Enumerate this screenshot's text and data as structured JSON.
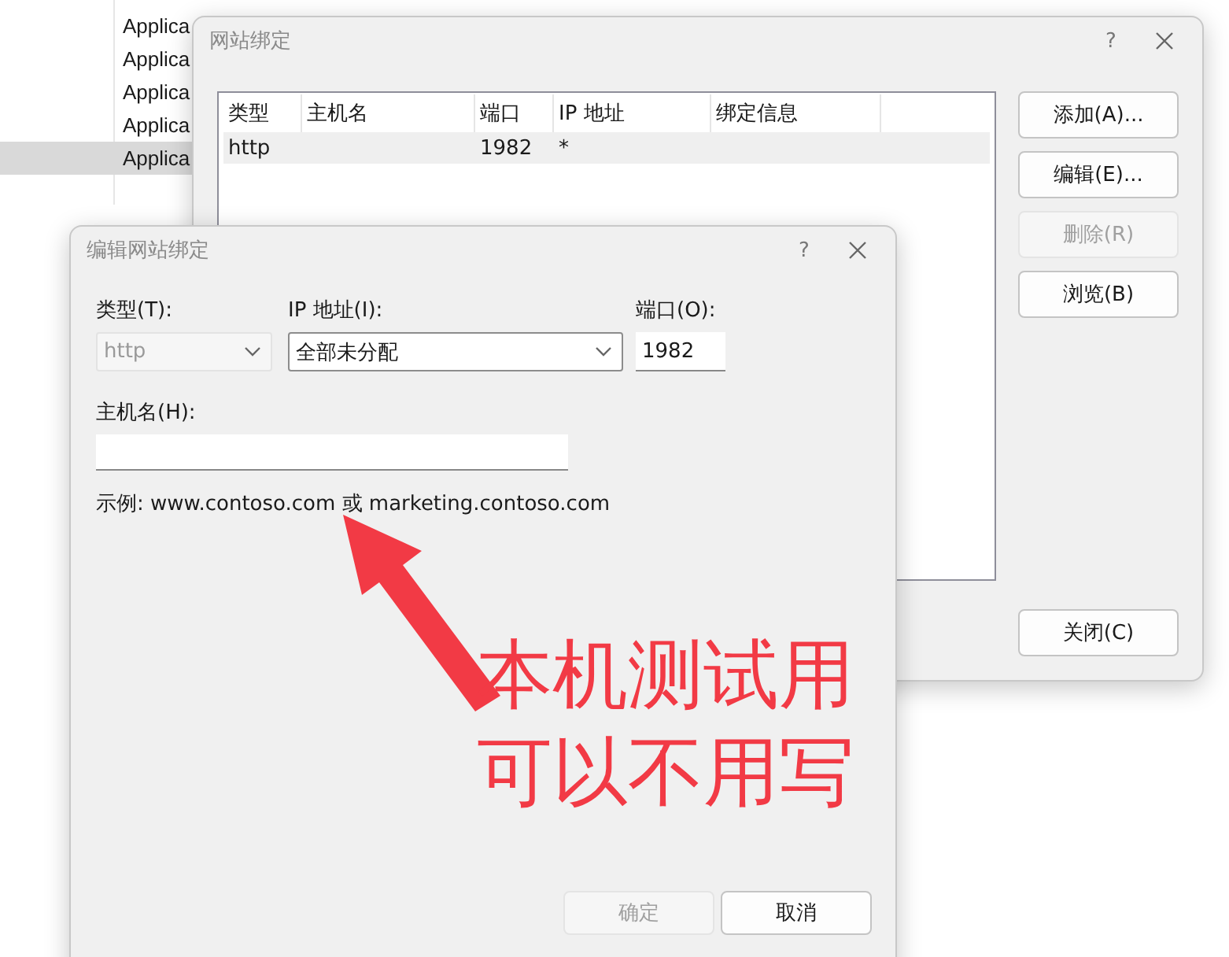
{
  "background_list": {
    "rows": [
      {
        "column_2": "Applica",
        "selected": false
      },
      {
        "column_2": "Applica",
        "selected": false
      },
      {
        "column_2": "Applica",
        "selected": false
      },
      {
        "column_2": "Applica",
        "selected": false
      },
      {
        "column_2": "Applica",
        "selected": true
      }
    ]
  },
  "bindings_dialog": {
    "title": "网站绑定",
    "help": "?",
    "columns": [
      "类型",
      "主机名",
      "端口",
      "IP 地址",
      "绑定信息"
    ],
    "rows": [
      {
        "type": "http",
        "port": "1982",
        "ip_address": "*",
        "selected": true
      }
    ],
    "buttons": [
      {
        "label": "添加(A)...",
        "disabled": false
      },
      {
        "label": "编辑(E)...",
        "disabled": false
      },
      {
        "label": "删除(R)",
        "disabled": true
      },
      {
        "label": "浏览(B)",
        "disabled": false
      }
    ],
    "close_button": {
      "label": "关闭(C)",
      "disabled": false
    }
  },
  "edit_dialog": {
    "title": "编辑网站绑定",
    "help": "?",
    "type": {
      "label": "类型(T):",
      "value": "http",
      "disabled": true
    },
    "ip_address": {
      "label": "IP 地址(I):",
      "value": "全部未分配",
      "disabled": false
    },
    "port": {
      "label": "端口(O):",
      "value": "1982"
    },
    "host_name": {
      "label": "主机名(H):"
    },
    "example": "示例: www.contoso.com 或 marketing.contoso.com",
    "buttons": [
      {
        "label": "确定",
        "disabled": true
      },
      {
        "label": "取消",
        "disabled": false
      }
    ]
  },
  "annotation": {
    "lines": [
      "本机测试用",
      "可以不用写"
    ]
  }
}
